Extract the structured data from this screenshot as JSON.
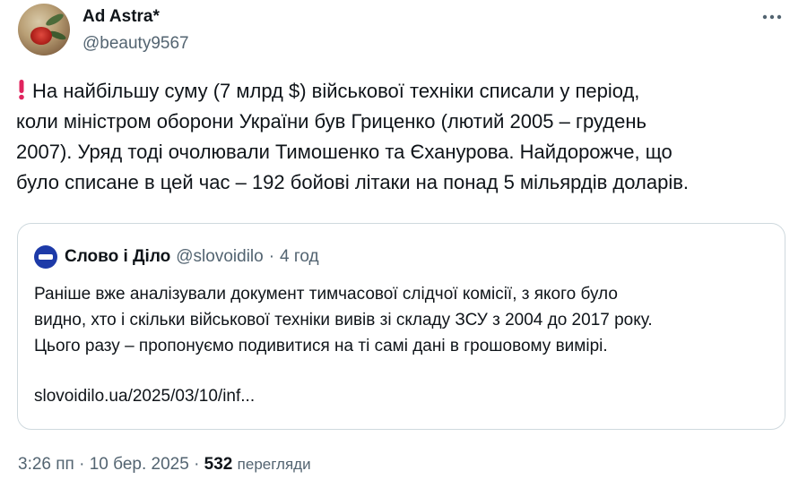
{
  "author": {
    "display_name": "Ad Astra*",
    "handle": "@beauty9567"
  },
  "tweet": {
    "icon": "exclamation-icon",
    "lines": [
      "На найбільшу суму (7 млрд $) військової техніки списали у період,",
      "коли міністром оборони України був Гриценко (лютий 2005 – грудень",
      "2007). Уряд тоді очолювали Тимошенко та Єханурова. Найдорожче, що",
      "було списане в цей час – 192 бойові літаки на понад 5 мільярдів доларів."
    ]
  },
  "quote": {
    "name": "Слово і Діло",
    "handle": "@slovoidilo",
    "separator": "·",
    "time": "4 год",
    "lines": [
      "Раніше вже аналізували документ тимчасової слідчої комісії, з якого було",
      "видно, хто і скільки військової техніки вивів зі складу ЗСУ з 2004 до 2017 року.",
      "Цього разу – пропонуємо подивитися на ті самі дані в грошовому вимірі."
    ],
    "link": "slovoidilo.ua/2025/03/10/inf..."
  },
  "meta": {
    "time": "3:26 пп",
    "separator": "·",
    "date": "10 бер. 2025",
    "views_count": "532",
    "views_label": "перегляди"
  },
  "colors": {
    "text": "#0f1419",
    "secondary": "#536471",
    "border": "#cfd9de",
    "alert_red": "#e0245e"
  }
}
